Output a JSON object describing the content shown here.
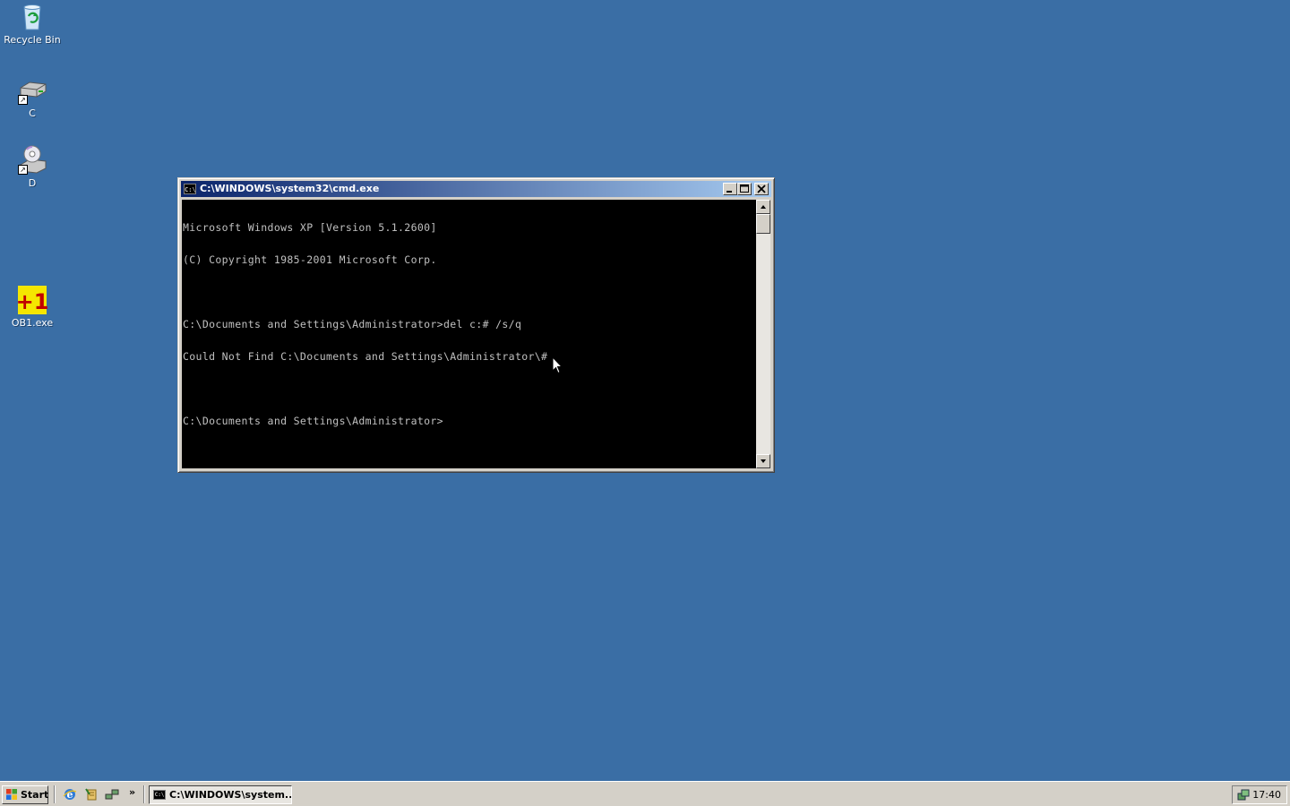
{
  "desktop": {
    "icons": [
      {
        "label": "Recycle Bin",
        "icon": "recycle-bin-icon"
      },
      {
        "label": "C",
        "icon": "hard-drive-icon"
      },
      {
        "label": "D",
        "icon": "cd-drive-icon"
      },
      {
        "label": "OB1.exe",
        "icon": "ob1-executable-icon"
      }
    ]
  },
  "window": {
    "title": "C:\\WINDOWS\\system32\\cmd.exe",
    "icon": "cmd-icon",
    "buttons": {
      "minimize": "minimize-icon",
      "maximize": "maximize-icon",
      "close": "close-icon"
    }
  },
  "console": {
    "lines": [
      "Microsoft Windows XP [Version 5.1.2600]",
      "(C) Copyright 1985-2001 Microsoft Corp.",
      "",
      "C:\\Documents and Settings\\Administrator>del c:# /s/q",
      "Could Not Find C:\\Documents and Settings\\Administrator\\#",
      "",
      "C:\\Documents and Settings\\Administrator>"
    ]
  },
  "taskbar": {
    "start_label": "Start",
    "quicklaunch": [
      "internet-explorer-icon",
      "outlook-express-icon",
      "network-icon"
    ],
    "chevron": "»",
    "task_label": "C:\\WINDOWS\\system...",
    "clock": "17:40"
  },
  "colors": {
    "desktop": "#3a6ea5",
    "titlebar_start": "#0a246a",
    "titlebar_end": "#a6caf0",
    "console_bg": "#000000",
    "console_fg": "#c0c0c0"
  }
}
